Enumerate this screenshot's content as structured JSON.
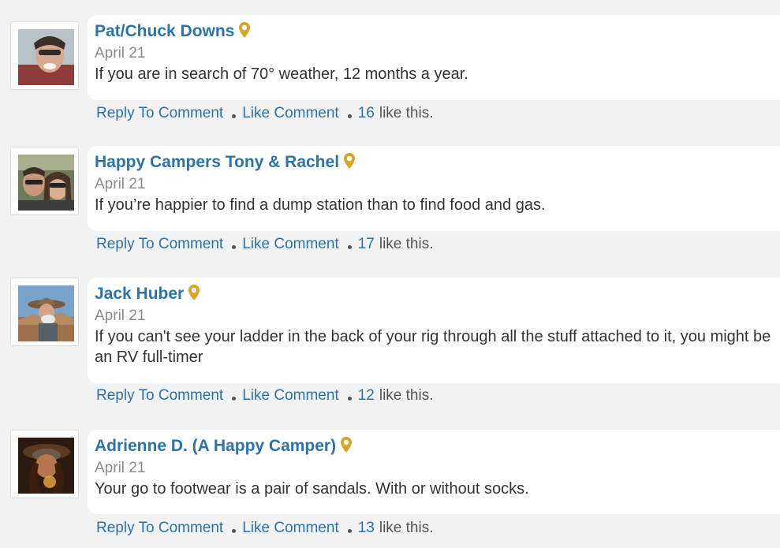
{
  "comments": [
    {
      "author": "Pat/Chuck Downs",
      "date": "April 21",
      "text": "If you are in search of 70° weather, 12 months a year.",
      "reply_label": "Reply To Comment",
      "like_label": "Like Comment",
      "like_count": "16",
      "like_suffix": "like this."
    },
    {
      "author": "Happy Campers Tony & Rachel",
      "date": "April 21",
      "text": "If you’re happier to find a dump station than to find food and gas.",
      "reply_label": "Reply To Comment",
      "like_label": "Like Comment",
      "like_count": "17",
      "like_suffix": "like this."
    },
    {
      "author": "Jack Huber",
      "date": "April 21",
      "text": "If you can't see your ladder in the back of your rig through all the stuff attached to it, you might be an RV full-timer",
      "reply_label": "Reply To Comment",
      "like_label": "Like Comment",
      "like_count": "12",
      "like_suffix": "like this."
    },
    {
      "author": "Adrienne D. (A Happy Camper)",
      "date": "April 21",
      "text": "Your go to footwear is a pair of sandals. With or without socks.",
      "reply_label": "Reply To Comment",
      "like_label": "Like Comment",
      "like_count": "13",
      "like_suffix": "like this."
    }
  ],
  "colors": {
    "link": "#2a73ad",
    "pin": "#d9a526",
    "background": "#f2f2f2",
    "bubble": "#ffffff"
  },
  "icons": {
    "location_badge": "map-pin-icon"
  }
}
